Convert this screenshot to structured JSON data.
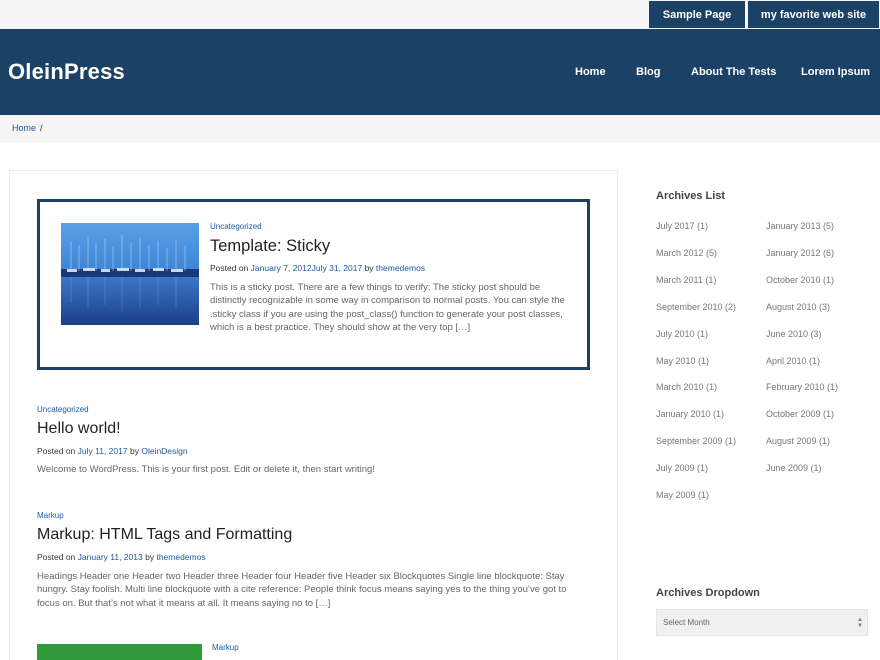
{
  "topbar": {
    "sample_page": "Sample Page",
    "favorite_site": "my favorite web site"
  },
  "header": {
    "logo": "OleinPress",
    "nav": [
      "Home",
      "Blog",
      "About The Tests",
      "Lorem Ipsum"
    ]
  },
  "breadcrumb": {
    "home": "Home",
    "separator": "/"
  },
  "posts": [
    {
      "category": "Uncategorized",
      "title": "Template: Sticky",
      "posted_on": "Posted on",
      "date": "January 7, 2012July 31, 2017",
      "by": "by",
      "author": "themedemos",
      "excerpt": "This is a sticky post. There are a few things to verify: The sticky post should be distinctly recognizable in some way in comparison to normal posts. You can style the .sticky class if you are using the post_class() function to generate your post classes, which is a best practice. They should show at the very top […]"
    },
    {
      "category": "Uncategorized",
      "title": "Hello world!",
      "posted_on": "Posted on",
      "date": "July 11, 2017",
      "by": "by",
      "author": "OleinDesign",
      "excerpt": "Welcome to WordPress. This is your first post. Edit or delete it, then start writing!"
    },
    {
      "category": "Markup",
      "title": "Markup: HTML Tags and Formatting",
      "posted_on": "Posted on",
      "date": "January 11, 2013",
      "by": "by",
      "author": "themedemos",
      "excerpt": "Headings Header one Header two Header three Header four Header five Header six Blockquotes Single line blockquote: Stay hungry. Stay foolish. Multi line blockquote with a cite reference: People think focus means saying yes to the thing you’ve got to focus on. But that’s not what it means at all. It means saying no to […]"
    },
    {
      "category": "Markup"
    }
  ],
  "sidebar": {
    "archives_list_title": "Archives List",
    "archives": [
      "July 2017 (1)",
      "January 2013 (5)",
      "March 2012 (5)",
      "January 2012 (6)",
      "March 2011 (1)",
      "October 2010 (1)",
      "September 2010 (2)",
      "August 2010 (3)",
      "July 2010 (1)",
      "June 2010 (3)",
      "May 2010 (1)",
      "April 2010 (1)",
      "March 2010 (1)",
      "February 2010 (1)",
      "January 2010 (1)",
      "October 2009 (1)",
      "September 2009 (1)",
      "August 2009 (1)",
      "July 2009 (1)",
      "June 2009 (1)",
      "May 2009 (1)"
    ],
    "archives_dropdown_title": "Archives Dropdown",
    "dropdown_selected": "Select Month"
  },
  "colors": {
    "brand": "#1c4167",
    "link": "#1e5aa0",
    "topbar_bg": "#f5f5f5"
  }
}
